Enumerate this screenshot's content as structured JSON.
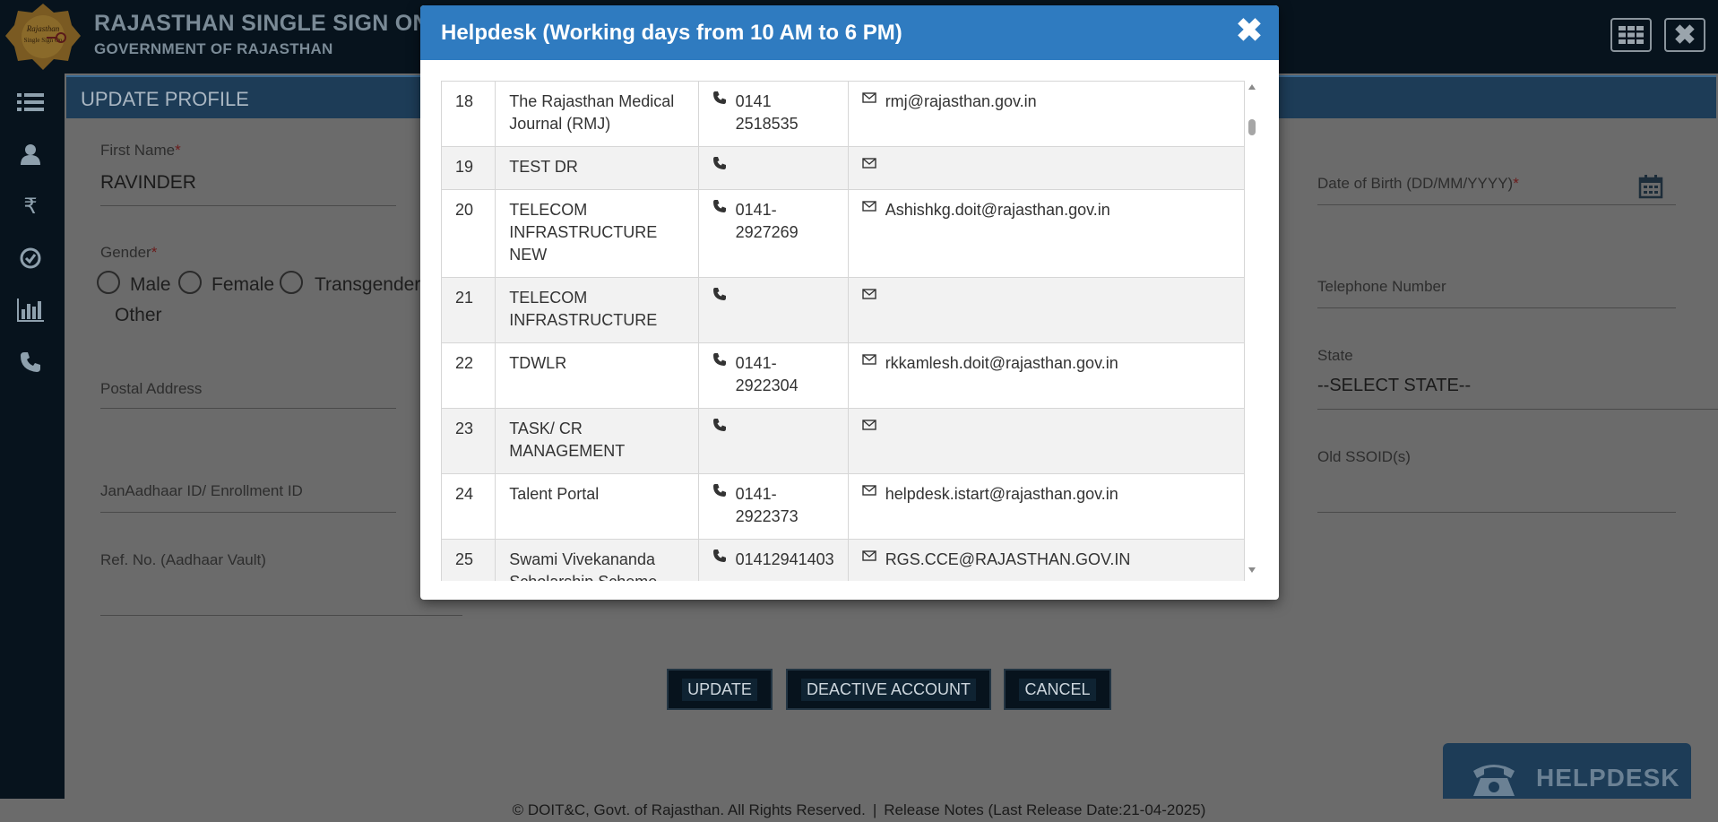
{
  "header": {
    "title": "RAJASTHAN SINGLE SIGN ON",
    "subtitle": "GOVERNMENT OF RAJASTHAN",
    "logo_text": "Rajasthan Single Sign On",
    "close_glyph": "✖"
  },
  "sidebar": {
    "items": [
      {
        "icon": "menu-list-icon"
      },
      {
        "icon": "user-icon"
      },
      {
        "icon": "rupee-icon"
      },
      {
        "icon": "check-circle-icon"
      },
      {
        "icon": "bar-chart-icon"
      },
      {
        "icon": "phone-icon"
      }
    ]
  },
  "panel": {
    "title": "UPDATE PROFILE"
  },
  "form": {
    "first_name_label": "First Name",
    "first_name_value": "RAVINDER",
    "gender_label": "Gender",
    "gender_options": [
      "Male",
      "Female",
      "Transgender",
      "Other"
    ],
    "postal_address_label": "Postal Address",
    "janaadhaar_label": "JanAadhaar ID/ Enrollment ID",
    "ref_no_label": "Ref. No. (Aadhaar Vault)",
    "dob_label": "Date of Birth (DD/MM/YYYY)",
    "telephone_label": "Telephone Number",
    "state_label": "State",
    "state_value": "--SELECT STATE--",
    "old_ssoid_label": "Old SSOID(s)",
    "required_mark": "*"
  },
  "actions": {
    "update": "UPDATE",
    "deactive": "DEACTIVE ACCOUNT",
    "cancel": "CANCEL"
  },
  "helpdesk_button": {
    "label": "HELPDESK"
  },
  "footer": {
    "copyright": "© DOIT&C, Govt. of Rajasthan. All Rights Reserved.",
    "separator": "|",
    "release_notes": "Release Notes (Last Release Date:21-04-2025)"
  },
  "modal": {
    "title": "Helpdesk (Working days from 10 AM to 6 PM)",
    "close_glyph": "✖",
    "rows": [
      {
        "no": "18",
        "name": "The Rajasthan Medical Journal (RMJ)",
        "phone": "0141 2518535",
        "email": "rmj@rajasthan.gov.in"
      },
      {
        "no": "19",
        "name": "TEST DR",
        "phone": "",
        "email": ""
      },
      {
        "no": "20",
        "name": "TELECOM INFRASTRUCTURE NEW",
        "phone": "0141-2927269",
        "email": "Ashishkg.doit@rajasthan.gov.in"
      },
      {
        "no": "21",
        "name": "TELECOM INFRASTRUCTURE",
        "phone": "",
        "email": ""
      },
      {
        "no": "22",
        "name": "TDWLR",
        "phone": "0141-2922304",
        "email": "rkkamlesh.doit@rajasthan.gov.in"
      },
      {
        "no": "23",
        "name": "TASK/ CR MANAGEMENT",
        "phone": "",
        "email": ""
      },
      {
        "no": "24",
        "name": "Talent Portal",
        "phone": "0141-2922373",
        "email": "helpdesk.istart@rajasthan.gov.in"
      },
      {
        "no": "25",
        "name": "Swami Vivekananda Scholarship Scheme",
        "phone": "01412941403",
        "email": "RGS.CCE@RAJASTHAN.GOV.IN"
      }
    ]
  }
}
